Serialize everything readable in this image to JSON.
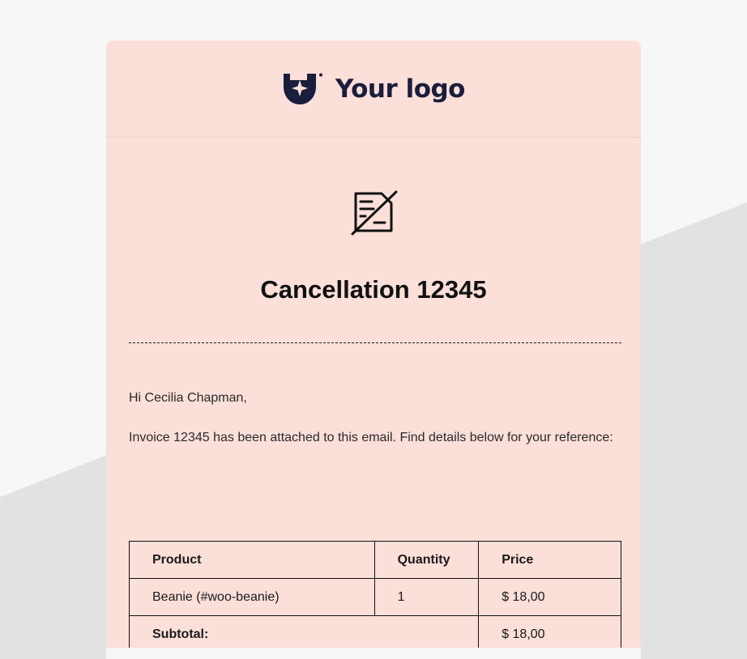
{
  "brand": {
    "logo_text": "Your logo",
    "logo_icon": "shield-sparkle-icon",
    "color": "#1a1d3b"
  },
  "hero": {
    "icon": "document-cancelled-icon",
    "title": "Cancellation 12345"
  },
  "message": {
    "greeting": "Hi Cecilia Chapman,",
    "body": "Invoice 12345 has been attached to this email. Find details below for your reference:"
  },
  "table": {
    "headers": {
      "product": "Product",
      "quantity": "Quantity",
      "price": "Price"
    },
    "rows": [
      {
        "product": "Beanie (#woo-beanie)",
        "quantity": "1",
        "price": "$ 18,00"
      }
    ],
    "subtotal_label": "Subtotal:",
    "subtotal_value": "$ 18,00"
  },
  "colors": {
    "card_background": "#fbdfd9",
    "page_background": "#f7f7f7",
    "diagonal_background": "#e2e2e2"
  }
}
